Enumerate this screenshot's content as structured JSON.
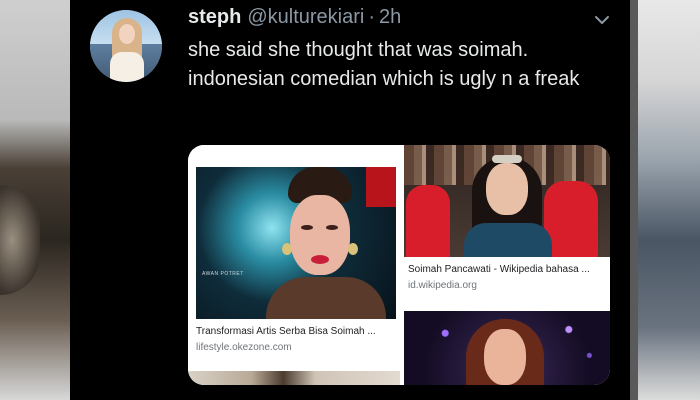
{
  "tweet": {
    "display_name": "steph",
    "handle": "@kulturekiari",
    "separator": "·",
    "timestamp": "2h",
    "text": "she said she thought that was soimah. indonesian comedian which is ugly n a freak"
  },
  "media": {
    "results": [
      {
        "title": "Transformasi Artis Serba Bisa Soimah ...",
        "source": "lifestyle.okezone.com",
        "watermark": "AWAN POTRET"
      },
      {
        "title": "Soimah Pancawati - Wikipedia bahasa ...",
        "source": "id.wikipedia.org"
      }
    ]
  },
  "icons": {
    "more": "chevron-down-icon"
  },
  "colors": {
    "tweet_bg": "#000000",
    "primary_text": "#e7e9ea",
    "secondary_text": "#8b98a5"
  }
}
